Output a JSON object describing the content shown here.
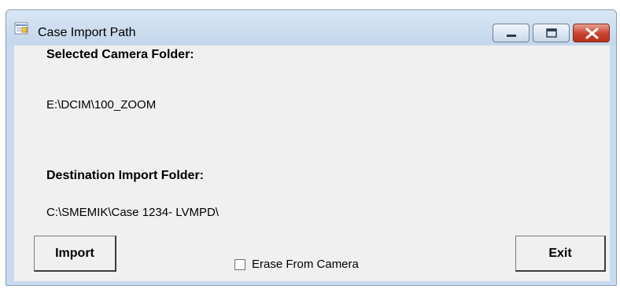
{
  "window": {
    "title": "Case Import Path",
    "controls": {
      "minimize_icon": "minimize-icon",
      "maximize_icon": "maximize-icon",
      "close_icon": "close-icon"
    }
  },
  "main": {
    "selected_camera_label": "Selected Camera Folder:",
    "selected_camera_path": "E:\\DCIM\\100_ZOOM",
    "destination_label": "Destination Import Folder:",
    "destination_path": "C:\\SMEMIK\\Case 1234- LVMPD\\",
    "import_button_label": "Import",
    "erase_checkbox_label": "Erase From Camera",
    "erase_checked": false,
    "exit_button_label": "Exit"
  },
  "colors": {
    "close_button": "#c8412c",
    "titlebar": "#c8daee",
    "client_background": "#f0f0f0"
  }
}
